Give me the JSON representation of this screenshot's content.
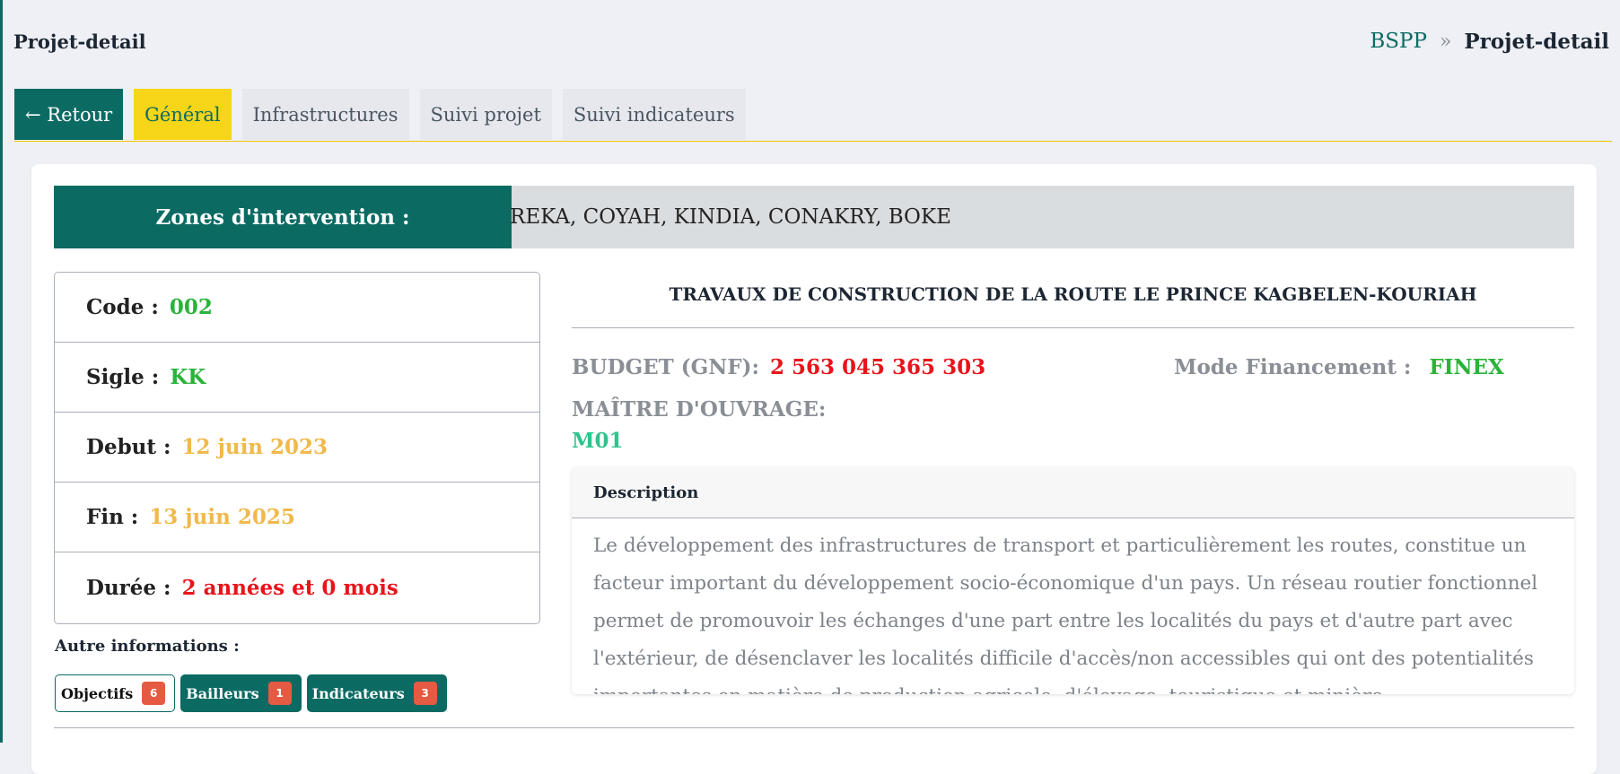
{
  "header": {
    "page_title": "Projet-detail",
    "breadcrumb": {
      "root": "BSPP",
      "separator": "»",
      "current": "Projet-detail"
    }
  },
  "tabs": [
    {
      "label": "← Retour"
    },
    {
      "label": "Général"
    },
    {
      "label": "Infrastructures"
    },
    {
      "label": "Suivi projet"
    },
    {
      "label": "Suivi indicateurs"
    }
  ],
  "zones": {
    "label": "Zones d'intervention :",
    "value": "REKA, COYAH, KINDIA, CONAKRY, BOKE"
  },
  "info": {
    "code": {
      "label": "Code :",
      "value": "002"
    },
    "sigle": {
      "label": "Sigle :",
      "value": "KK"
    },
    "debut": {
      "label": "Debut :",
      "value": "12 juin 2023"
    },
    "fin": {
      "label": "Fin :",
      "value": "13 juin 2025"
    },
    "duree": {
      "label": "Durée :",
      "value": "2 années et 0 mois"
    }
  },
  "other": {
    "title": "Autre informations :",
    "buttons": [
      {
        "label": "Objectifs",
        "count": "6"
      },
      {
        "label": "Bailleurs",
        "count": "1"
      },
      {
        "label": "Indicateurs",
        "count": "3"
      }
    ]
  },
  "project": {
    "title": "TRAVAUX DE CONSTRUCTION DE LA ROUTE LE PRINCE KAGBELEN-KOURIAH",
    "budget_label": "BUDGET (GNF):",
    "budget_value": "2 563 045 365 303",
    "mode_label": "Mode Financement :",
    "mode_value": "FINEX",
    "maitre_label": "MAÎTRE D'OUVRAGE:",
    "maitre_value": "M01"
  },
  "description": {
    "heading": "Description",
    "text": "Le développement des infrastructures de transport et particulièrement les routes, constitue un facteur important du développement socio-économique d'un pays. Un réseau routier fonctionnel permet de promouvoir les échanges d'une part entre les localités du pays et d'autre part avec l'extérieur, de désenclaver les localités difficile d'accès/non accessibles qui ont des potentialités importantes en matière de production agricole, d'élevage, touristique et minière."
  },
  "colors": {
    "primary": "#0b6b63",
    "active_tab": "#f7d518",
    "green": "#2ab33a",
    "amber": "#f0b94a",
    "red": "#e8141b",
    "teal_value": "#2ec48e"
  }
}
